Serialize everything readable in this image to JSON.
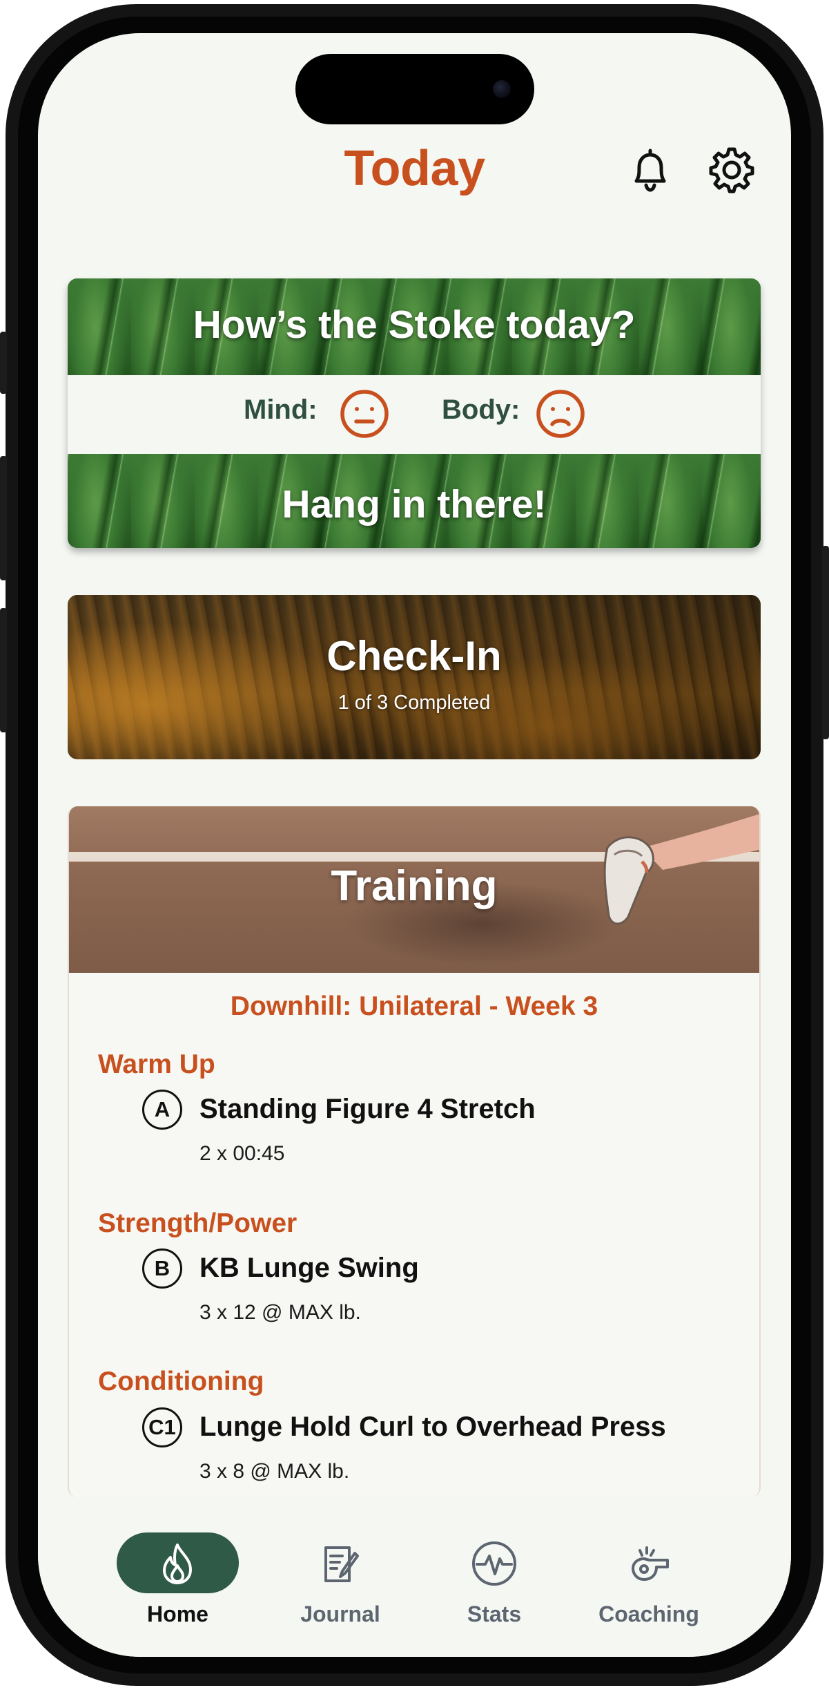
{
  "header": {
    "title": "Today"
  },
  "icons": {
    "bell": "bell-icon",
    "settings": "gear-icon"
  },
  "stoke": {
    "question": "How’s the Stoke today?",
    "mind_label": "Mind:",
    "mind_mood": "neutral",
    "body_label": "Body:",
    "body_mood": "sad",
    "message": "Hang in there!"
  },
  "checkin": {
    "title": "Check-In",
    "subtitle": "1 of 3 Completed",
    "completed": 1,
    "total": 3
  },
  "training": {
    "title": "Training",
    "program": "Downhill: Unilateral - Week 3",
    "sections": [
      {
        "title": "Warm Up",
        "exercises": [
          {
            "badge": "A",
            "name": "Standing Figure 4 Stretch",
            "detail": "2 x 00:45"
          }
        ]
      },
      {
        "title": "Strength/Power",
        "exercises": [
          {
            "badge": "B",
            "name": "KB Lunge Swing",
            "detail": "3 x 12 @ MAX lb."
          }
        ]
      },
      {
        "title": "Conditioning",
        "exercises": [
          {
            "badge": "C1",
            "name": "Lunge Hold Curl to Overhead Press",
            "detail": "3 x 8 @ MAX lb."
          }
        ]
      }
    ]
  },
  "tabs": [
    {
      "label": "Home",
      "icon": "flame-icon",
      "active": true
    },
    {
      "label": "Journal",
      "icon": "journal-icon",
      "active": false
    },
    {
      "label": "Stats",
      "icon": "pulse-icon",
      "active": false
    },
    {
      "label": "Coaching",
      "icon": "whistle-icon",
      "active": false
    }
  ],
  "colors": {
    "accent": "#c8501e",
    "tab_active": "#2f5a48",
    "mood_label": "#2f4f42",
    "background": "#f5f7f3"
  }
}
